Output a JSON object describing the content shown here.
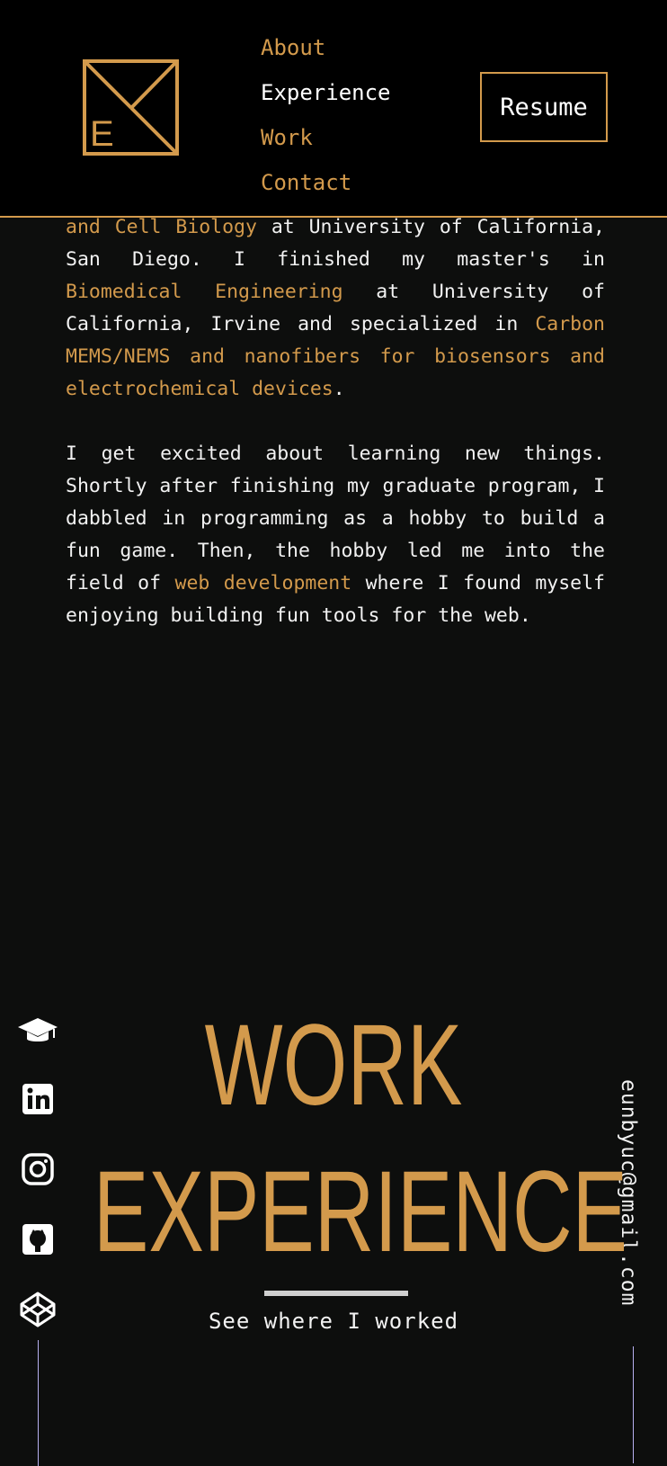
{
  "header": {
    "logo_letter": "E",
    "nav": [
      "About",
      "Experience",
      "Work",
      "Contact"
    ],
    "resume_label": "Resume"
  },
  "about": {
    "p1_hl1": "and Cell Biology",
    "p1_t1": " at University of California, San Diego. I finished my master's in ",
    "p1_hl2": "Biomedical Engineering",
    "p1_t2": " at University of California, Irvine and specialized in ",
    "p1_hl3": "Carbon MEMS/NEMS and nanofibers for biosensors and electrochemical devices",
    "p1_t3": ".",
    "p2_t1": "I get excited about learning new things. Shortly after finishing my graduate program, I dabbled in programming as a hobby to build a fun game. Then, the hobby led me into the field of ",
    "p2_hl1": "web development",
    "p2_t2": " where I found myself enjoying building fun tools for the web."
  },
  "social_icons": [
    "graduation-cap-icon",
    "linkedin-icon",
    "instagram-icon",
    "github-icon",
    "codepen-icon"
  ],
  "email": "eunbyuc@gmail.com",
  "section": {
    "title_line1": "WORK",
    "title_line2": "EXPERIENCE",
    "subtitle": "See where I worked"
  },
  "colors": {
    "accent": "#d39a4c",
    "background": "#0d0e0d",
    "header_bg": "#000000",
    "text": "#f2f2f2",
    "line": "#b7b0f0"
  }
}
